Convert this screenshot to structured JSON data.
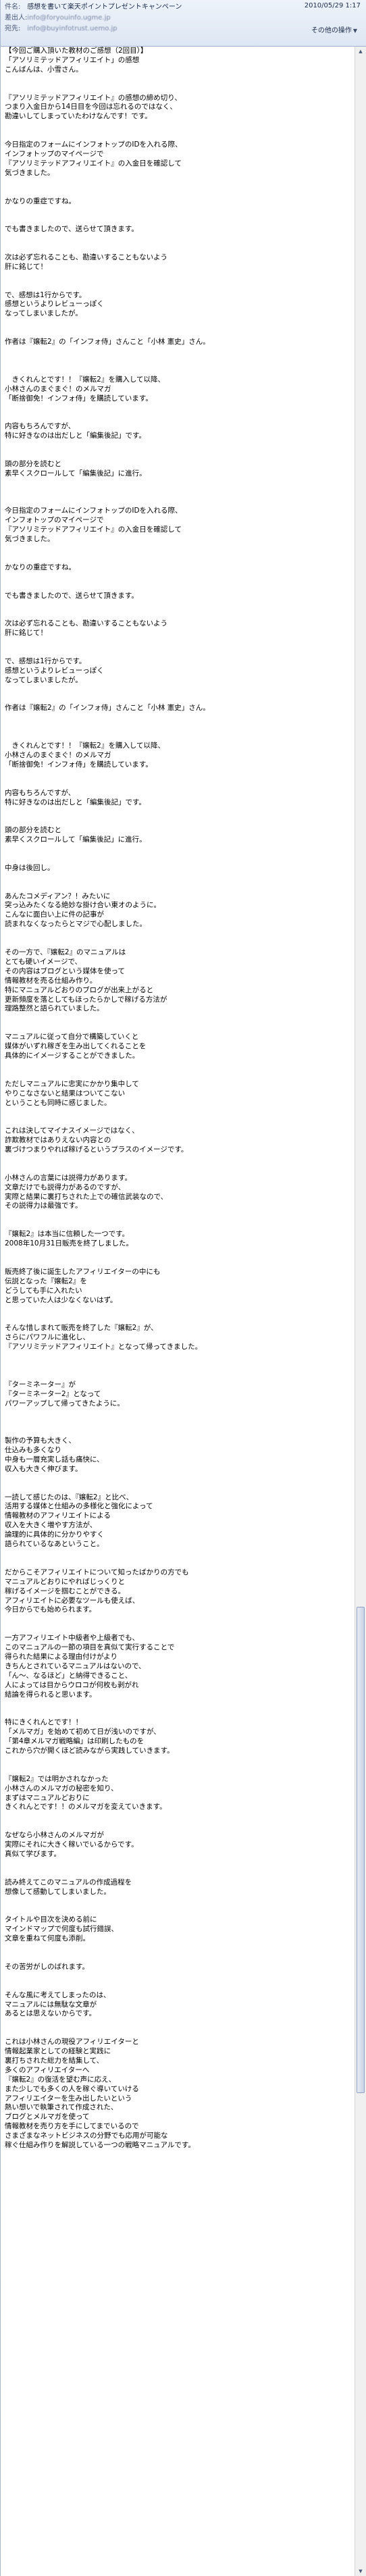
{
  "header": {
    "subject_label": "件名:",
    "subject": "感想を書いて楽天ポイントプレゼントキャンペーン",
    "from_label": "差出人:",
    "from": "info@foryouinfo.ugme.jp",
    "date": "2010/05/29 1:17",
    "to_label": "宛先:",
    "to": "info@buyinfotrust.uemo.jp",
    "other_info": "その他の操作"
  },
  "body": {
    "text": "【今回ご購入頂いた教材のご感想（2回目）】\n「アソリミテッドアフィリエイト」の感想\nこんばんは、小雪さん。\n\n\n『アソリミテッドアフィリエイト』の感想の締め切り、\nつまり入金日から14日目を今回は忘れるのではなく、\n勘違いしてしまっていたわけなんです！です。\n\n\n今日指定のフォームにインフォトップのIDを入れる際、\nインフォトップのマイページで\n『アソリミテッドアフィリエイト』の入金日を確認して\n気づきました。\n\n\nかなりの重症ですね。\n\n\nでも書きましたので、送らせて頂きます。\n\n\n次は必ず忘れることも、勘違いすることもないよう\n肝に銘じて！\n\n\nで、感想は1行からです。\n感想というよりレビューっぽく\nなってしまいましたが。\n\n\n作者は『嬢転2』の「インフォ侍」さんこと「小林 憲史」さん。\n\n\n\n　きくれんとです！！『嬢転2』を購入して以降、\n小林さんのまぐまぐ！のメルマガ\n「断捨御免！インフォ侍」を購読しています。\n\n\n内容もちろんですが、\n特に好きなのは出だしと「編集後記」です。\n\n\n頭の部分を読むと\n素早くスクロールして「編集後記」に進行。\n\n\n\n今日指定のフォームにインフォトップのIDを入れる際、\nインフォトップのマイページで\n『アソリミテッドアフィリエイト』の入金日を確認して\n気づきました。\n\n\nかなりの重症ですね。\n\n\nでも書きましたので、送らせて頂きます。\n\n\n次は必ず忘れることも、勘違いすることもないよう\n肝に銘じて！\n\n\nで、感想は1行からです。\n感想というよりレビューっぽく\nなってしまいましたが。\n\n\n作者は『嬢転2』の「インフォ侍」さんこと「小林 憲史」さん。\n\n\n\n　きくれんとです！！『嬢転2』を購入して以降、\n小林さんのまぐまぐ！のメルマガ\n「断捨御免！インフォ侍」を購読しています。\n\n\n内容もちろんですが、\n特に好きなのは出だしと「編集後記」です。\n\n\n頭の部分を読むと\n素早くスクロールして「編集後記」に進行。\n\n\n中身は後回し。\n\n\nあんたコメディアン？！みたいに\n突っ込みたくなる絶妙な掛け合い東オのように。\nこんなに面白い上に件の記事が\n読まれなくなったらとマジで心配しました。\n\n\nその一方で、『嬢転2』のマニュアルは\nとても硬いイメージで、\nその内容はブログという媒体を使って\n情報教材を売る仕組み作り。\n特にマニュアルどおりのブログが出来上がると\n更新頻度を落としてもほったらかしで稼げる方法が\n理路整然と語られていました。\n\n\nマニュアルに従って自分で構築していくと\n媒体がいずれ稼ぎを生み出してくれることを\n具体的にイメージすることができました。\n\n\nただしマニュアルに忠実にかかり集中して\nやりこなさないと結果はついてこない\nということも同時に感じました。\n\n\nこれは決してマイナスイメージではなく、\n詐欺教材ではありえない内容との\n裏づけつまりやれば稼げるというプラスのイメージです。\n\n\n小林さんの言葉には説得力があります。\n文章だけでも説得力があるのですが、\n実際と結果に裏打ちされた上での確信武装なので、\nその説得力は最強です。\n\n\n『嬢転2』は本当に信頼した一つです。\n2008年10月31日販売を終了しました。\n\n\n販売終了後に誕生したアフィリエイターの中にも\n伝説となった『嬢転2』を\nどうしても手に入れたい\nと思っていた人は少なくないはず。\n\n\nそんな惜しまれて販売を終了した『嬢転2』が、\nさらにパワフルに進化し、\n『アソリミテッドアフィリエイト』となって帰ってきました。\n\n\n\n『ターミネーター』が\n『ターミネーター2』となって\nパワーアップして帰ってきたように。\n\n\n\n製作の予算も大きく、\n仕込みも多くなり\n中身も一層充実し話も痛快に、\n収入も大きく伸びます。\n\n\n一読して感じたのは、『嬢転2』と比べ、\n活用する媒体と仕組みの多様化と強化によって\n情報教材のアフィリエイトによる\n収入を大きく増やす方法が、\n論理的に具体的に分かりやすく\n語られているなあということ。\n\n\nだからこそアフィリエイトについて知ったばかりの方でも\nマニュアルどおりにやればじっくりと\n稼げるイメージを掴むことができる。\nアフィリエイトに必要なツールも使えば、\n今日からでも始められます。\n\n\n一方アフィリエイト中級者や上級者でも、\nこのマニュアルの一節の項目を真似て実行することで\n得られた結果による理由付けがより\nきちんとされているマニュアルはないので、\n「ん～、なるほど」と納得できること、\n人によっては目からウロコが何枚も剥がれ\n結論を得られると思います。\n\n\n特にきくれんとです！！\n「メルマガ」を始めて初めて日が浅いのですが、\n「第4章メルマガ戦略編」は印刷したものを\nこれから穴が開くほど読みながら実践していきます。\n\n\n『嬢転2』では明かされなかった\n小林さんのメルマガの秘密を知り、\nまずはマニュアルどおりに\nきくれんとです！！のメルマガを変えていきます。\n\n\nなぜなら小林さんのメルマガが\n実際にそれに大きく稼いでいるからです。\n真似て学びます。\n\n\n読み終えてこのマニュアルの作成過程を\n想像して感動してしまいました。\n\n\nタイトルや目次を決める前に\nマインドマップで何度も試行錯誤、\n文章を重ねて何度も添削。\n\n\nその苦労がしのばれます。\n\n\nそんな風に考えてしまったのは、\nマニュアルには無駄な文章が\nあるとは思えないからです。\n\n\nこれは小林さんの現役アフィリエイターと\n情報起業家としての経験と実践に\n裏打ちされた総力を結集して、\n多くのアフィリエイターへ\n『嬢転2』の復活を望む声に応え、\nまた少しでも多くの人を稼ぐ導いていける\nアフィリエイターを生み出したいという\n熱い想いで執筆されて作成された、\nブログとメルマガを使って\n情報教材を売り方を手にしてまでいるので\nさまざまなネットビジネスの分野でも応用が可能な\n稼ぐ仕組み作りを解説している一つの戦略マニュアルです。"
  }
}
